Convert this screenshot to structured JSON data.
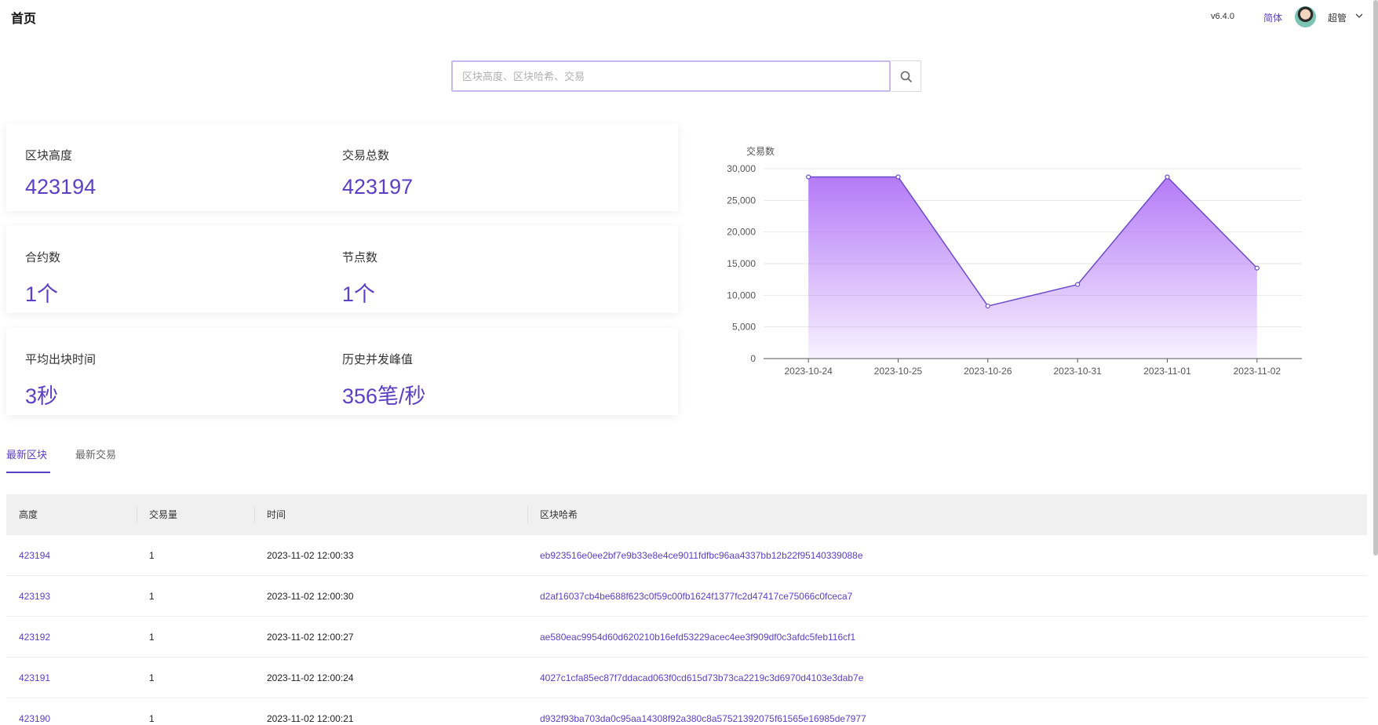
{
  "header": {
    "title": "首页",
    "version": "v6.4.0",
    "language": "简体",
    "username": "超管"
  },
  "search": {
    "placeholder": "区块高度、区块哈希、交易",
    "value": ""
  },
  "stats": [
    {
      "label": "区块高度",
      "value": "423194"
    },
    {
      "label": "交易总数",
      "value": "423197"
    },
    {
      "label": "合约数",
      "value": "1个"
    },
    {
      "label": "节点数",
      "value": "1个"
    },
    {
      "label": "平均出块时间",
      "value": "3秒"
    },
    {
      "label": "历史并发峰值",
      "value": "356笔/秒"
    }
  ],
  "chart_data": {
    "type": "area",
    "ylabel": "交易数",
    "categories": [
      "2023-10-24",
      "2023-10-25",
      "2023-10-26",
      "2023-10-31",
      "2023-11-01",
      "2023-11-02"
    ],
    "values": [
      28700,
      28700,
      8300,
      11700,
      28700,
      14300
    ],
    "ylim": [
      0,
      30000
    ],
    "yticks": [
      0,
      5000,
      10000,
      15000,
      20000,
      25000,
      30000
    ],
    "ytick_labels": [
      "0",
      "5,000",
      "10,000",
      "15,000",
      "20,000",
      "25,000",
      "30,000"
    ],
    "grid": true,
    "line_color": "#6b4bc9",
    "fill_color": "#b57bf7"
  },
  "tabs": [
    {
      "label": "最新区块",
      "active": true
    },
    {
      "label": "最新交易",
      "active": false
    }
  ],
  "table": {
    "columns": [
      "高度",
      "交易量",
      "时间",
      "区块哈希"
    ],
    "rows": [
      {
        "height": "423194",
        "tx": "1",
        "time": "2023-11-02 12:00:33",
        "hash": "eb923516e0ee2bf7e9b33e8e4ce9011fdfbc96aa4337bb12b22f95140339088e"
      },
      {
        "height": "423193",
        "tx": "1",
        "time": "2023-11-02 12:00:30",
        "hash": "d2af16037cb4be688f623c0f59c00fb1624f1377fc2d47417ce75066c0fceca7"
      },
      {
        "height": "423192",
        "tx": "1",
        "time": "2023-11-02 12:00:27",
        "hash": "ae580eac9954d60d620210b16efd53229acec4ee3f909df0c3afdc5feb116cf1"
      },
      {
        "height": "423191",
        "tx": "1",
        "time": "2023-11-02 12:00:24",
        "hash": "4027c1cfa85ec87f7ddacad063f0cd615d73b73ca2219c3d6970d4103e3dab7e"
      },
      {
        "height": "423190",
        "tx": "1",
        "time": "2023-11-02 12:00:21",
        "hash": "d932f93ba703da0c95aa14308f92a380c8a57521392075f61565e16985de7977"
      }
    ]
  },
  "colors": {
    "accent": "#5b3fc4"
  }
}
